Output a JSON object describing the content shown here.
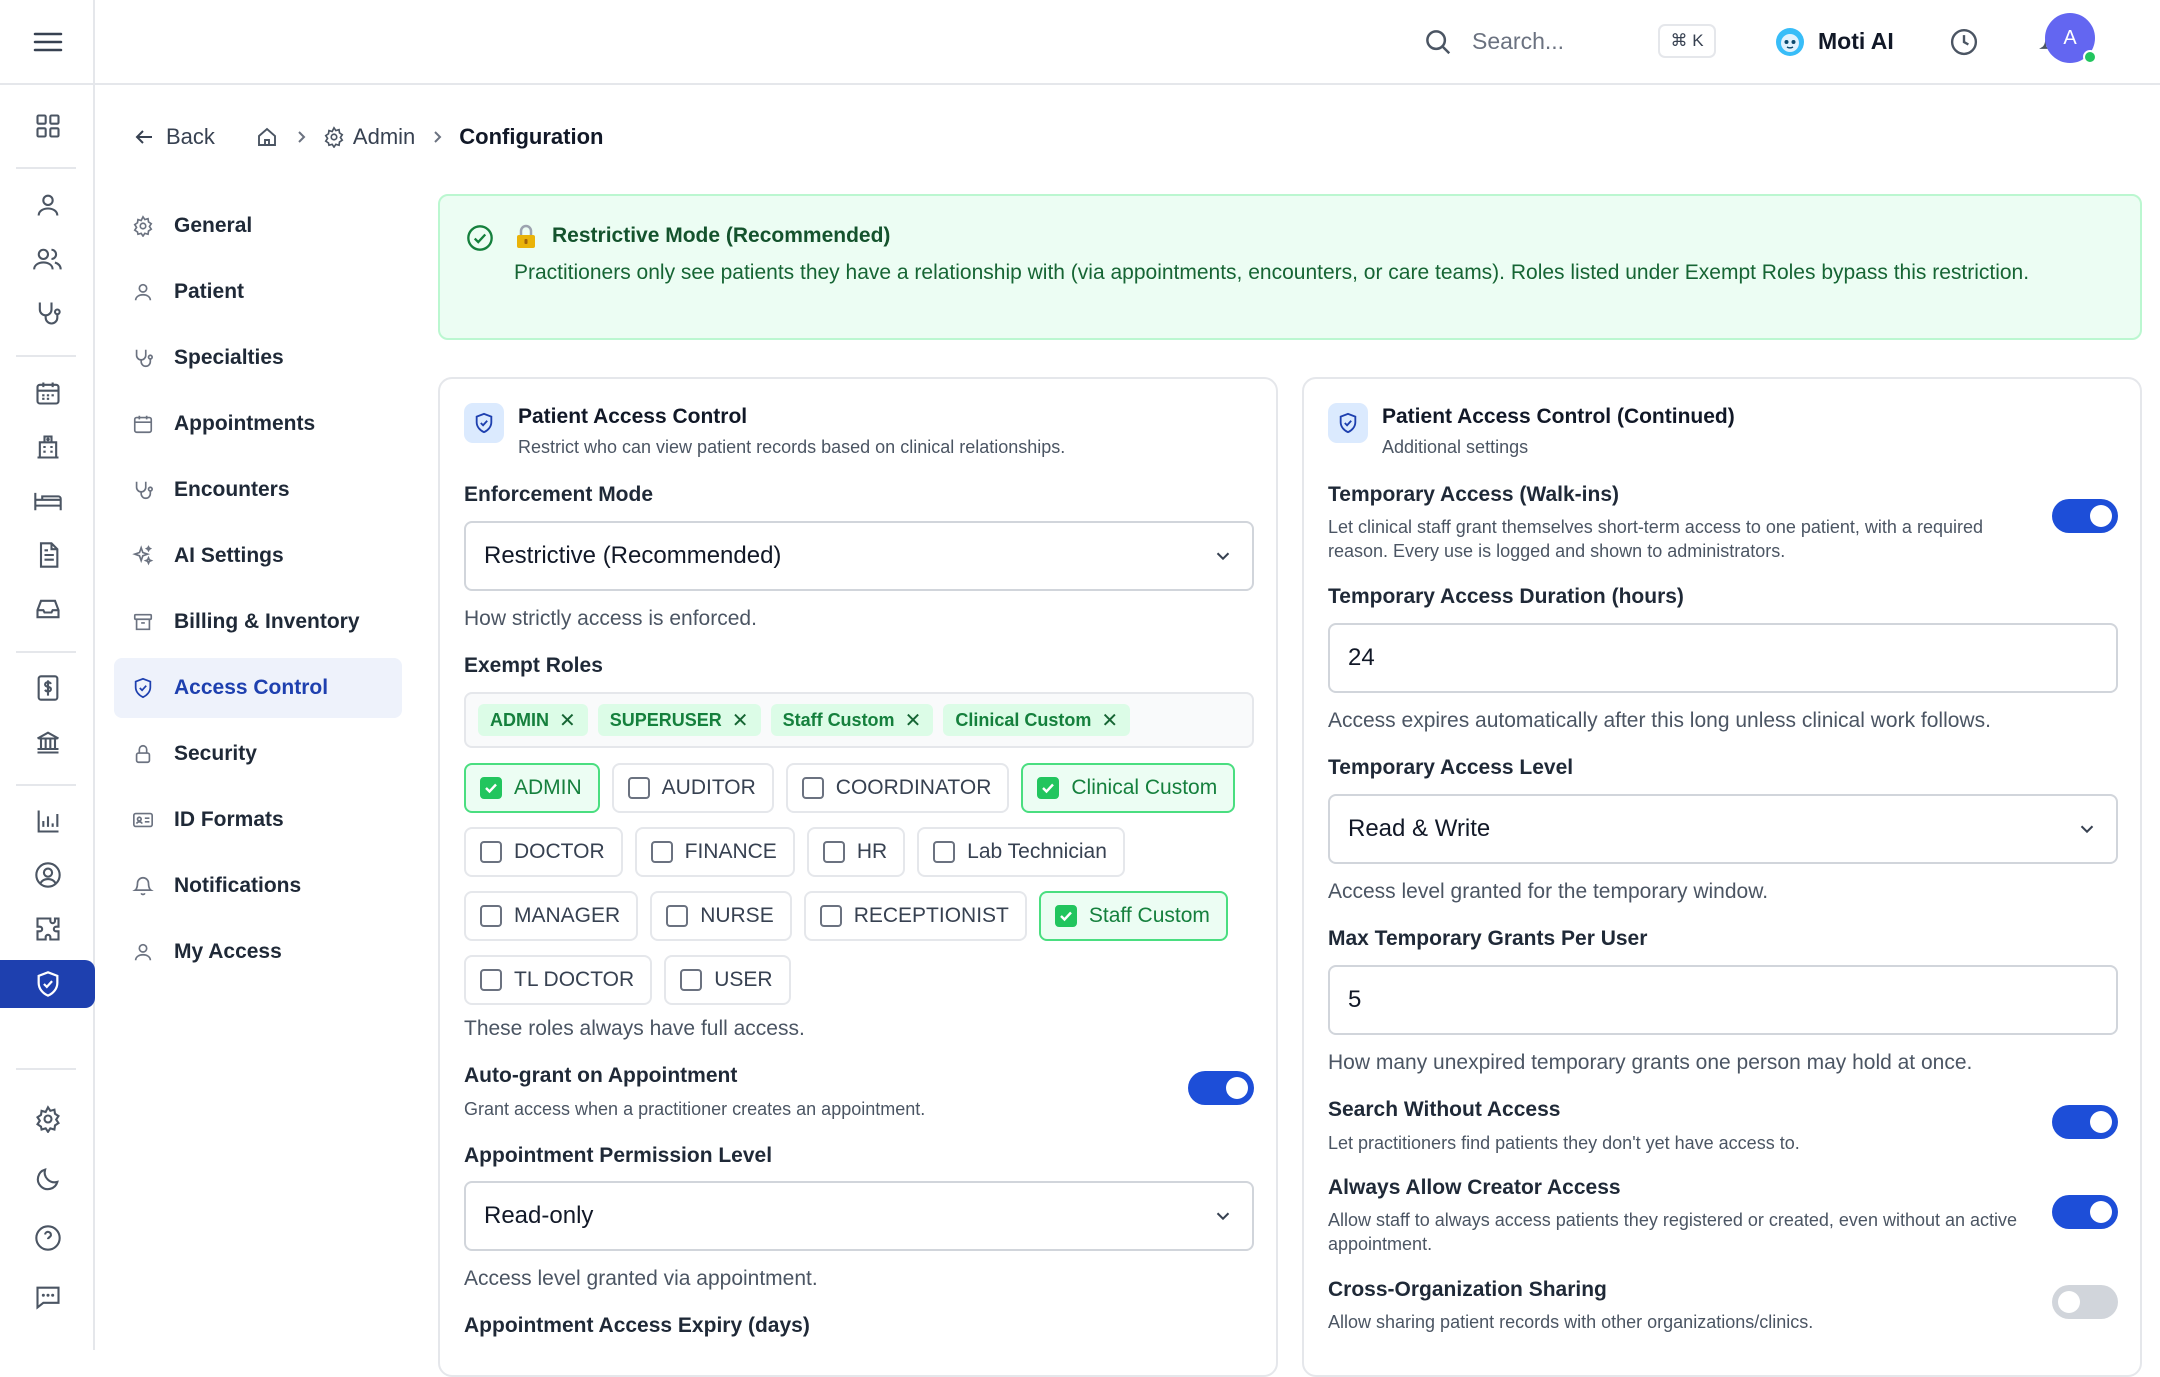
{
  "colors": {
    "accent": "#1e40af",
    "toggle_on": "#1d4ed8",
    "success": "#15803d",
    "success_bg": "#ecfdf3"
  },
  "topbar": {
    "search_placeholder": "Search...",
    "shortcut": "⌘ K",
    "assistant_label": "Moti AI",
    "avatar_initial": "A"
  },
  "rail_icons": [
    "menu-icon",
    "dashboard-icon",
    "person-icon",
    "people-icon",
    "stethoscope-icon",
    "calendar-icon",
    "hospital-icon",
    "bed-icon",
    "document-icon",
    "inbox-icon",
    "dollar-icon",
    "bank-icon",
    "chart-icon",
    "user-circle-icon",
    "puzzle-icon",
    "shield-icon",
    "gear-icon",
    "moon-icon",
    "help-icon",
    "chat-icon"
  ],
  "breadcrumb": {
    "back": "Back",
    "admin": "Admin",
    "current": "Configuration"
  },
  "subnav": [
    {
      "label": "General",
      "icon": "gear-icon"
    },
    {
      "label": "Patient",
      "icon": "person-icon"
    },
    {
      "label": "Specialties",
      "icon": "stethoscope-icon"
    },
    {
      "label": "Appointments",
      "icon": "calendar-icon"
    },
    {
      "label": "Encounters",
      "icon": "stethoscope-icon"
    },
    {
      "label": "AI Settings",
      "icon": "sparkle-icon"
    },
    {
      "label": "Billing & Inventory",
      "icon": "archive-icon"
    },
    {
      "label": "Access Control",
      "icon": "shield-icon",
      "active": true
    },
    {
      "label": "Security",
      "icon": "lock-icon"
    },
    {
      "label": "ID Formats",
      "icon": "id-card-icon"
    },
    {
      "label": "Notifications",
      "icon": "bell-icon"
    },
    {
      "label": "My Access",
      "icon": "person-icon"
    }
  ],
  "banner": {
    "title": "Restrictive Mode (Recommended)",
    "text": "Practitioners only see patients they have a relationship with (via appointments, encounters, or care teams). Roles listed under Exempt Roles bypass this restriction."
  },
  "left_card": {
    "title": "Patient Access Control",
    "subtitle": "Restrict who can view patient records based on clinical relationships.",
    "enforcement_label": "Enforcement Mode",
    "enforcement_value": "Restrictive (Recommended)",
    "enforcement_hint": "How strictly access is enforced.",
    "exempt_label": "Exempt Roles",
    "exempt_chips": [
      "ADMIN",
      "SUPERUSER",
      "Staff Custom",
      "Clinical Custom"
    ],
    "roles": [
      [
        {
          "label": "ADMIN",
          "checked": true
        },
        {
          "label": "AUDITOR",
          "checked": false
        },
        {
          "label": "COORDINATOR",
          "checked": false
        },
        {
          "label": "Clinical Custom",
          "checked": true
        }
      ],
      [
        {
          "label": "DOCTOR",
          "checked": false
        },
        {
          "label": "FINANCE",
          "checked": false
        },
        {
          "label": "HR",
          "checked": false
        },
        {
          "label": "Lab Technician",
          "checked": false
        }
      ],
      [
        {
          "label": "MANAGER",
          "checked": false
        },
        {
          "label": "NURSE",
          "checked": false
        },
        {
          "label": "RECEPTIONIST",
          "checked": false
        },
        {
          "label": "Staff Custom",
          "checked": true
        }
      ],
      [
        {
          "label": "TL DOCTOR",
          "checked": false
        },
        {
          "label": "USER",
          "checked": false
        }
      ]
    ],
    "exempt_hint": "These roles always have full access.",
    "autogrant_label": "Auto-grant on Appointment",
    "autogrant_desc": "Grant access when a practitioner creates an appointment.",
    "autogrant_on": true,
    "perm_label": "Appointment Permission Level",
    "perm_value": "Read-only",
    "perm_hint": "Access level granted via appointment.",
    "expiry_label": "Appointment Access Expiry (days)"
  },
  "right_card": {
    "title": "Patient Access Control (Continued)",
    "subtitle": "Additional settings",
    "temp_label": "Temporary Access (Walk-ins)",
    "temp_desc": "Let clinical staff grant themselves short-term access to one patient, with a required reason. Every use is logged and shown to administrators.",
    "temp_on": true,
    "duration_label": "Temporary Access Duration (hours)",
    "duration_value": "24",
    "duration_hint": "Access expires automatically after this long unless clinical work follows.",
    "level_label": "Temporary Access Level",
    "level_value": "Read & Write",
    "level_hint": "Access level granted for the temporary window.",
    "max_label": "Max Temporary Grants Per User",
    "max_value": "5",
    "max_hint": "How many unexpired temporary grants one person may hold at once.",
    "search_label": "Search Without Access",
    "search_desc": "Let practitioners find patients they don't yet have access to.",
    "search_on": true,
    "creator_label": "Always Allow Creator Access",
    "creator_desc": "Allow staff to always access patients they registered or created, even without an active appointment.",
    "creator_on": true,
    "cross_label": "Cross-Organization Sharing",
    "cross_desc": "Allow sharing patient records with other organizations/clinics.",
    "cross_on": false
  }
}
